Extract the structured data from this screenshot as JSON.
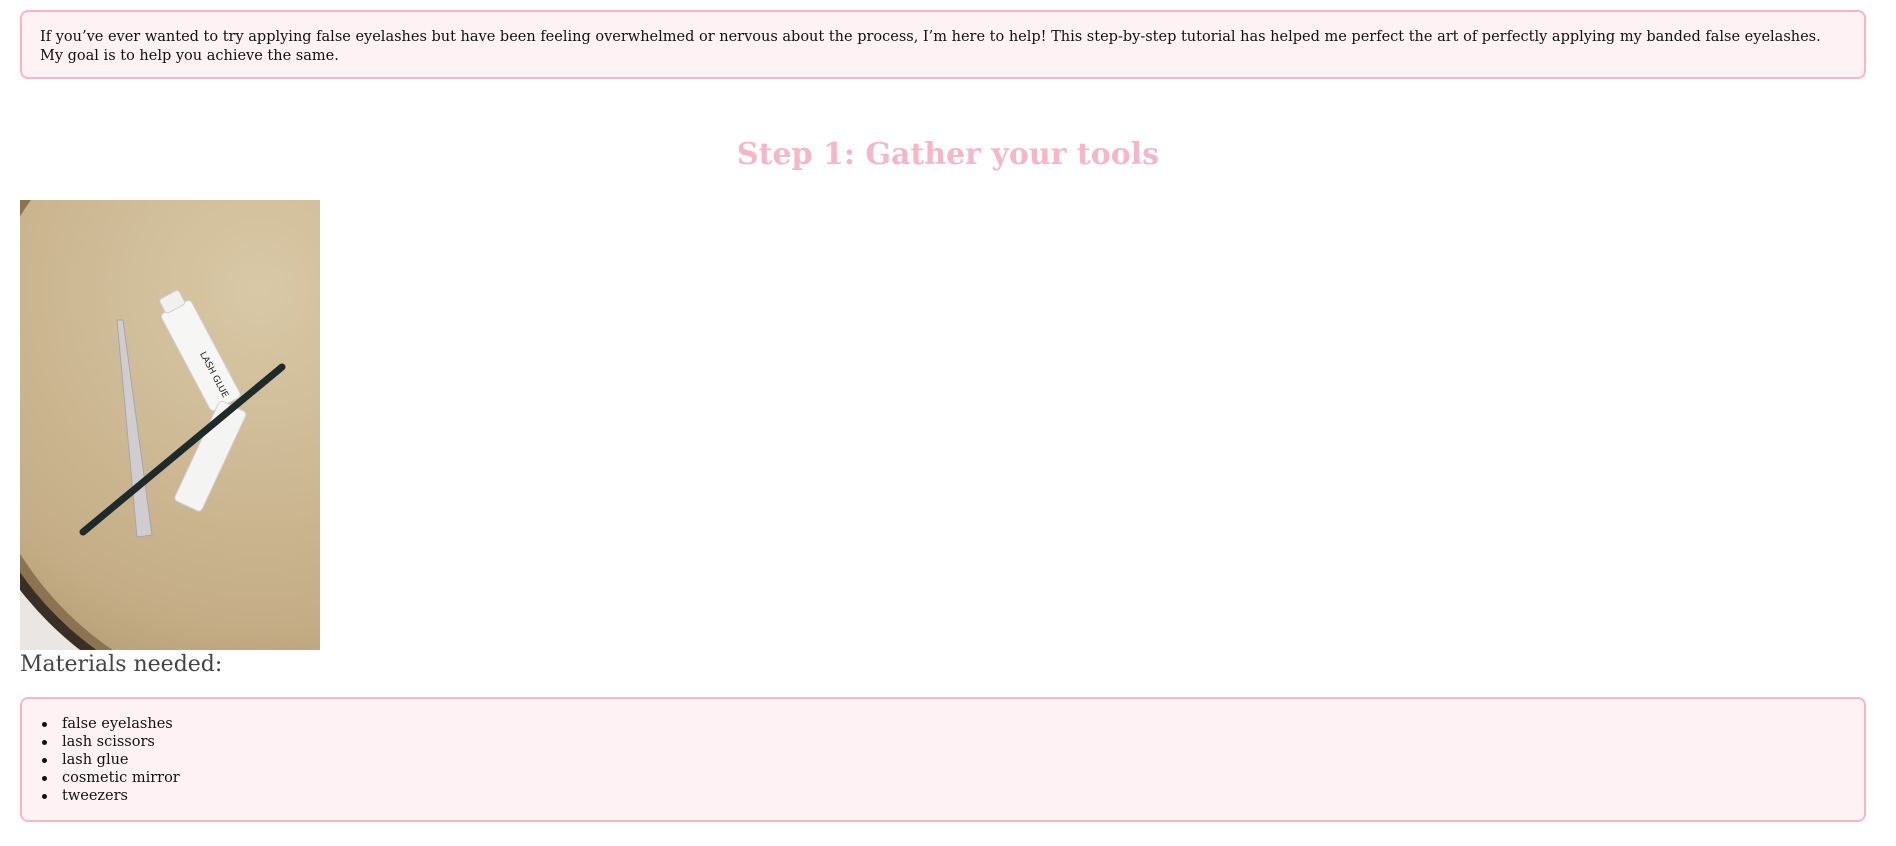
{
  "intro": {
    "text": "If you’ve ever wanted to try applying false eyelashes but have been feeling overwhelmed or nervous about the process, I’m here to help! This step-by-step tutorial has helped me perfect the art of perfectly applying my banded false eyelashes. My goal is to help you achieve the same."
  },
  "step1": {
    "title": "Step 1: Gather your tools"
  },
  "photo": {
    "tube_brand": "LASH GLUE"
  },
  "materials": {
    "heading": "Materials needed:",
    "items": [
      {
        "label": "false eyelashes"
      },
      {
        "label": "lash scissors"
      },
      {
        "label": "lash glue"
      },
      {
        "label": "cosmetic mirror"
      },
      {
        "label": "tweezers"
      }
    ]
  },
  "colors": {
    "accent_pink": "#f7b6c8",
    "box_background": "#fff2f5",
    "tray_beige": "#c9b38e"
  }
}
